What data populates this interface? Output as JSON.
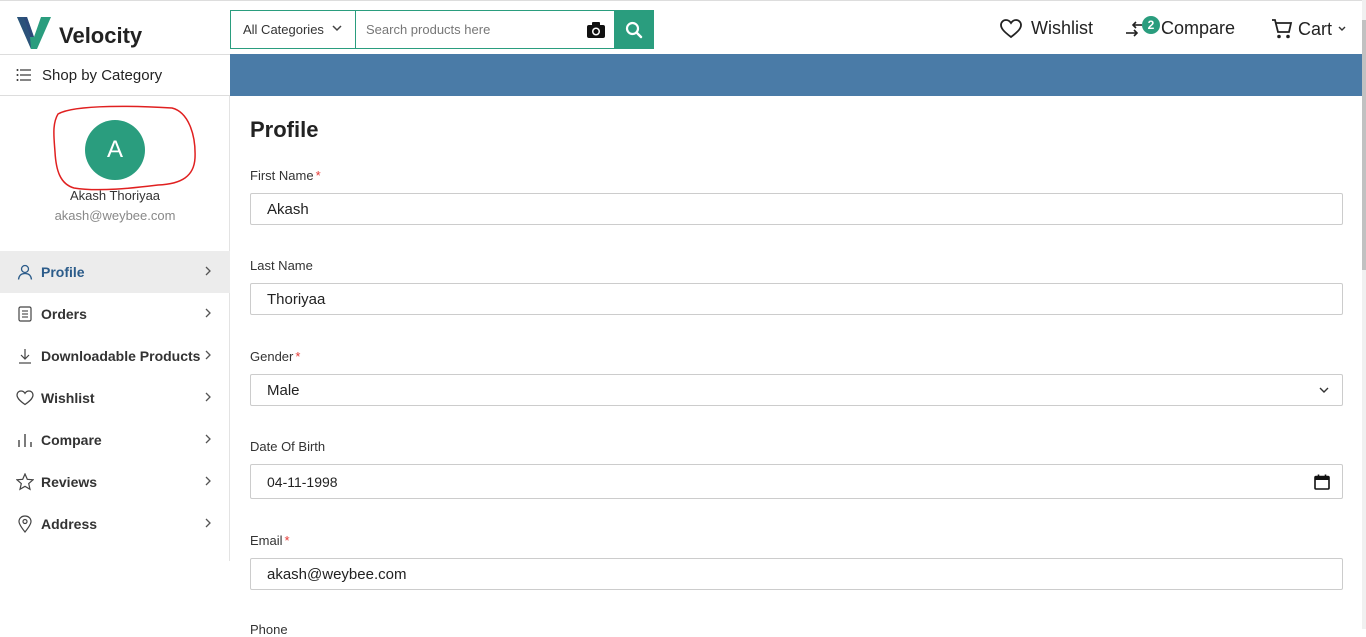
{
  "header": {
    "brand": "Velocity",
    "brand_colors": {
      "primary": "#2a9d7e",
      "navy": "#2c4a7a"
    },
    "search": {
      "category_selected": "All Categories",
      "placeholder": "Search products here"
    },
    "wishlist_label": "Wishlist",
    "compare_label": "Compare",
    "compare_count": "2",
    "cart_label": "Cart"
  },
  "nav": {
    "shop_by_category": "Shop by Category",
    "banner_color": "#4a7ba7"
  },
  "sidebar": {
    "avatar_initial": "A",
    "user_name": "Akash Thoriyaa",
    "user_email": "akash@weybee.com",
    "items": [
      {
        "label": "Profile",
        "icon": "user-icon",
        "active": true
      },
      {
        "label": "Orders",
        "icon": "orders-icon",
        "active": false
      },
      {
        "label": "Downloadable Products",
        "icon": "download-icon",
        "active": false
      },
      {
        "label": "Wishlist",
        "icon": "heart-icon",
        "active": false
      },
      {
        "label": "Compare",
        "icon": "compare-icon",
        "active": false
      },
      {
        "label": "Reviews",
        "icon": "star-icon",
        "active": false
      },
      {
        "label": "Address",
        "icon": "location-icon",
        "active": false
      }
    ]
  },
  "profile": {
    "title": "Profile",
    "first_name": {
      "label": "First Name",
      "value": "Akash",
      "required": true
    },
    "last_name": {
      "label": "Last Name",
      "value": "Thoriyaa",
      "required": false
    },
    "gender": {
      "label": "Gender",
      "value": "Male",
      "required": true
    },
    "dob": {
      "label": "Date Of Birth",
      "value": "04-11-1998",
      "required": false
    },
    "email": {
      "label": "Email",
      "value": "akash@weybee.com",
      "required": true
    },
    "phone": {
      "label": "Phone"
    }
  }
}
